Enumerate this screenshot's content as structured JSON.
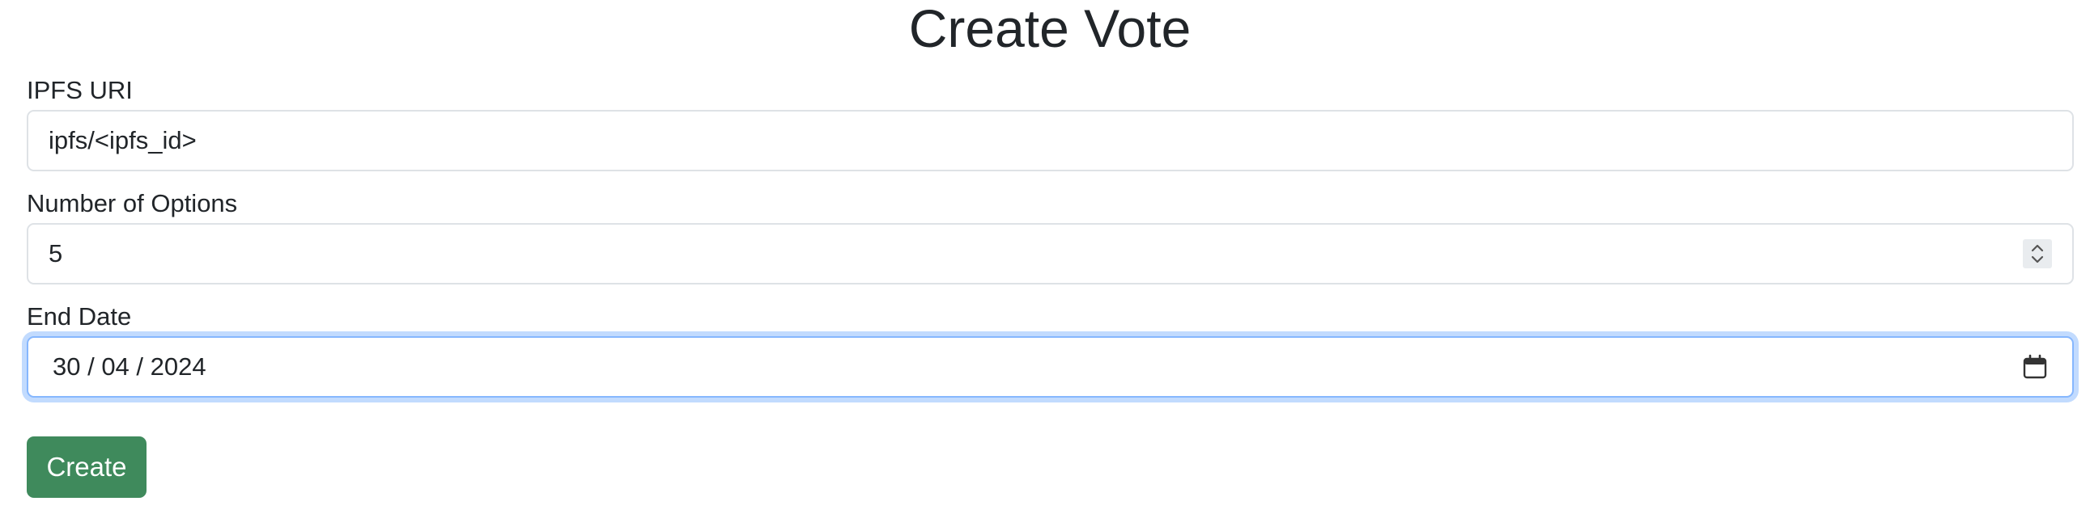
{
  "page": {
    "title": "Create Vote"
  },
  "form": {
    "ipfs_uri": {
      "label": "IPFS URI",
      "value": "ipfs/<ipfs_id>"
    },
    "num_options": {
      "label": "Number of Options",
      "value": "5"
    },
    "end_date": {
      "label": "End Date",
      "value": "30 / 04 / 2024"
    },
    "submit_label": "Create"
  },
  "icons": {
    "spinner": "chevron-up-down-icon",
    "calendar": "calendar-icon"
  },
  "colors": {
    "button": "#3f8a5c",
    "focus_ring": "#86b7fe",
    "border": "#dee2e6"
  }
}
